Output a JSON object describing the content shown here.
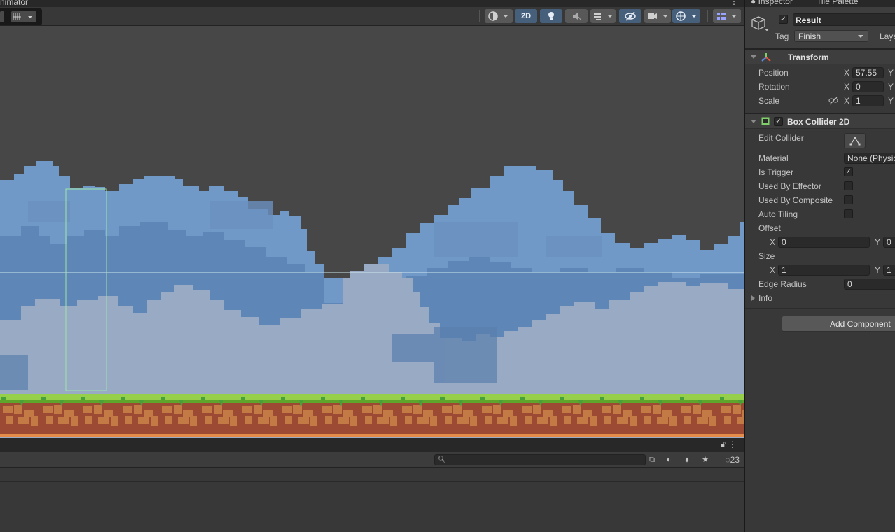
{
  "scene": {
    "tab_label": "nimator",
    "toolbar": {
      "mode_2d_label": "2D"
    }
  },
  "project": {
    "search_placeholder": "",
    "hidden_count": "23"
  },
  "inspector": {
    "tabs": [
      "Inspector",
      "Tile Palette"
    ],
    "object_name": "Result",
    "tag_label": "Tag",
    "tag_value": "Finish",
    "layer_label": "Laye",
    "transform": {
      "title": "Transform",
      "position_label": "Position",
      "position_x": "57.55",
      "rotation_label": "Rotation",
      "rotation_x": "0",
      "scale_label": "Scale",
      "scale_x": "1",
      "axis_x": "X",
      "axis_y": "Y"
    },
    "box_collider": {
      "title": "Box Collider 2D",
      "edit_collider_label": "Edit Collider",
      "material_label": "Material",
      "material_value": "None (Physic",
      "is_trigger_label": "Is Trigger",
      "is_trigger": true,
      "used_by_effector_label": "Used By Effector",
      "used_by_composite_label": "Used By Composite",
      "auto_tiling_label": "Auto Tiling",
      "offset_label": "Offset",
      "offset_x": "0",
      "offset_y": "0",
      "size_label": "Size",
      "size_x": "1",
      "size_y": "1",
      "edge_radius_label": "Edge Radius",
      "edge_radius": "0",
      "info_label": "Info"
    },
    "add_component_label": "Add Component"
  },
  "colors": {
    "sky": "#474747",
    "cloud_back": "#6f99c8",
    "cloud_mid": "#5d84b4",
    "cloud_front": "#97a9c2",
    "grass": "#96d04a",
    "dirt": "#9c4a33",
    "collider_outline": "#9ee6a8",
    "accent_button": "#46607c"
  }
}
